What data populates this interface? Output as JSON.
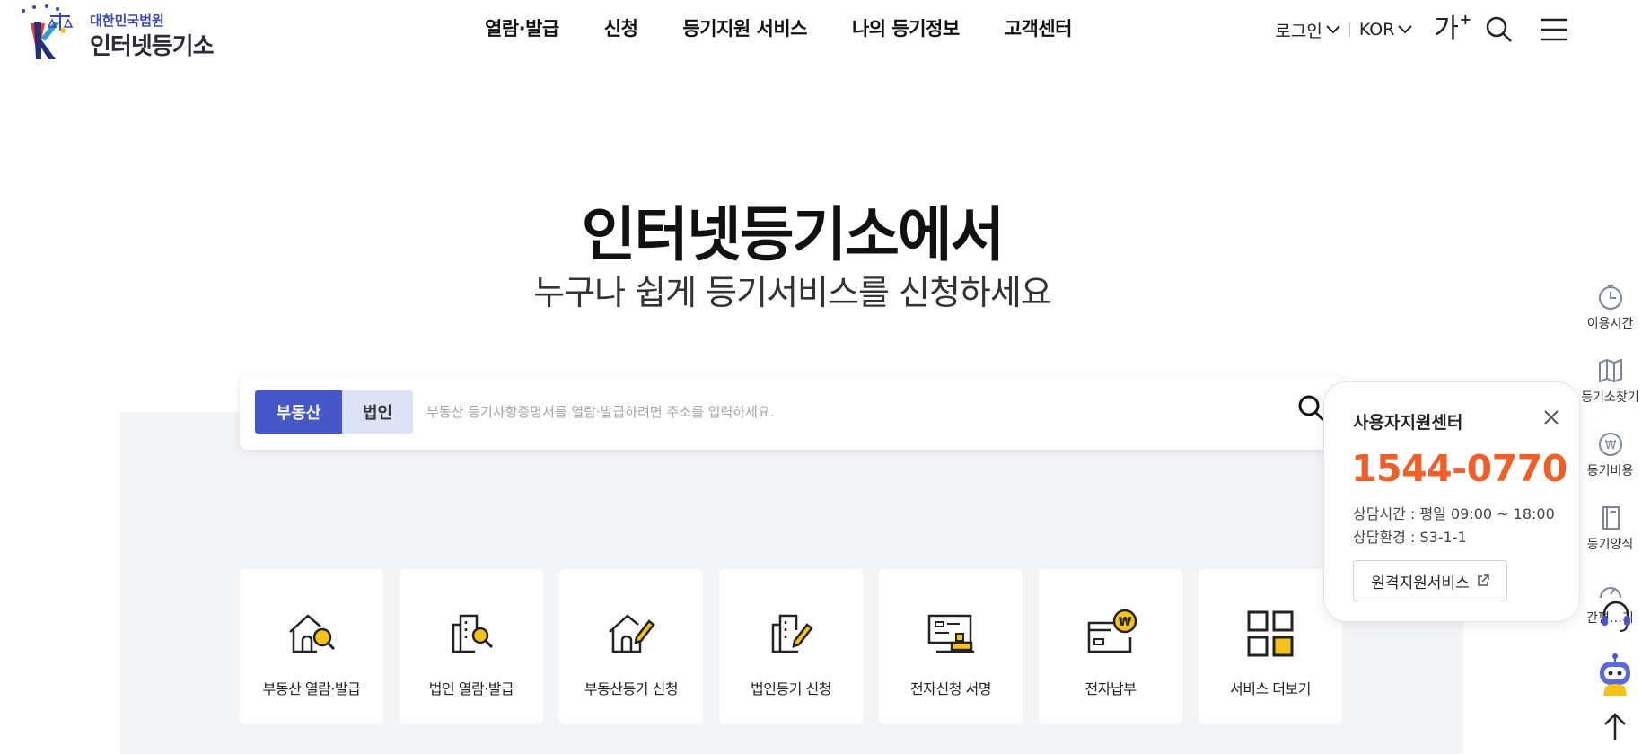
{
  "header": {
    "logo_sub": "대한민국법원",
    "logo_main": "인터넷등기소",
    "nav": [
      "열람·발급",
      "신청",
      "등기지원 서비스",
      "나의 등기정보",
      "고객센터"
    ],
    "login_label": "로그인",
    "lang_label": "KOR",
    "font_size_label": "가",
    "font_size_plus": "+"
  },
  "hero": {
    "title": "인터넷등기소에서",
    "subtitle": "누구나 쉽게 등기서비스를 신청하세요"
  },
  "search": {
    "tab_real_estate": "부동산",
    "tab_corporation": "법인",
    "placeholder": "부동산 등기사항증명서를 열람·발급하려면 주소를 입력하세요."
  },
  "services": [
    {
      "label": "부동산 열람·발급",
      "icon": "house-search-icon"
    },
    {
      "label": "법인 열람·발급",
      "icon": "building-search-icon"
    },
    {
      "label": "부동산등기 신청",
      "icon": "house-edit-icon"
    },
    {
      "label": "법인등기 신청",
      "icon": "building-edit-icon"
    },
    {
      "label": "전자신청 서명",
      "icon": "e-sign-icon"
    },
    {
      "label": "전자납부",
      "icon": "e-payment-icon"
    },
    {
      "label": "서비스 더보기",
      "icon": "grid-more-icon"
    }
  ],
  "support": {
    "title": "사용자지원센터",
    "phone": "1544-0770",
    "hours": "상담시간 : 평일 09:00 ~ 18:00",
    "env": "상담환경 : S3-1-1",
    "remote_label": "원격지원서비스"
  },
  "quick_menu": [
    {
      "label": "이용시간",
      "icon": "clock-icon"
    },
    {
      "label": "등기소찾기",
      "icon": "map-icon"
    },
    {
      "label": "등기비용",
      "icon": "won-coin-icon"
    },
    {
      "label": "등기양식",
      "icon": "book-icon"
    },
    {
      "label": "간편…기",
      "icon": "gauge-icon"
    }
  ],
  "colors": {
    "primary": "#4657c7",
    "primary_light": "#dde2f6",
    "accent_orange": "#ef5f2a",
    "accent_yellow": "#f5c21b",
    "panel_bg": "#f3f4f6"
  }
}
